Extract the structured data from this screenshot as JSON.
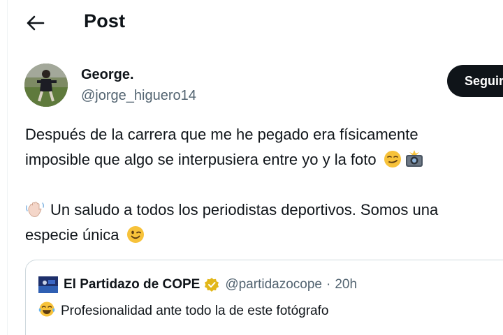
{
  "header": {
    "title": "Post",
    "back_icon": "arrow-left-icon"
  },
  "author": {
    "display_name": "George.",
    "handle": "@jorge_higuero14",
    "follow_label": "Seguir"
  },
  "tweet": {
    "line1": "Después de la carrera que me he pegado era físicamente",
    "line2": "imposible que algo se interpusiera entre yo y la foto",
    "line2_emojis": [
      "smirking-face-emoji",
      "camera-with-flash-emoji"
    ],
    "line3": "Un saludo a todos los periodistas deportivos. Somos una",
    "line3_emoji": "waving-hand-emoji",
    "line4": "especie única",
    "line4_emoji": "winking-face-emoji"
  },
  "quote": {
    "name": "El Partidazo de COPE",
    "handle": "@partidazocope",
    "separator": "·",
    "time": "20h",
    "text": "Profesionalidad ante todo la de este fotógrafo",
    "text_emoji": "face-with-tears-of-joy-emoji",
    "verified_icon": "verified-badge-icon"
  },
  "colors": {
    "text": "#0f1419",
    "secondary": "#536471",
    "border": "#cfd9de",
    "button_bg": "#0f1419",
    "verified_gold": "#e2b719"
  }
}
